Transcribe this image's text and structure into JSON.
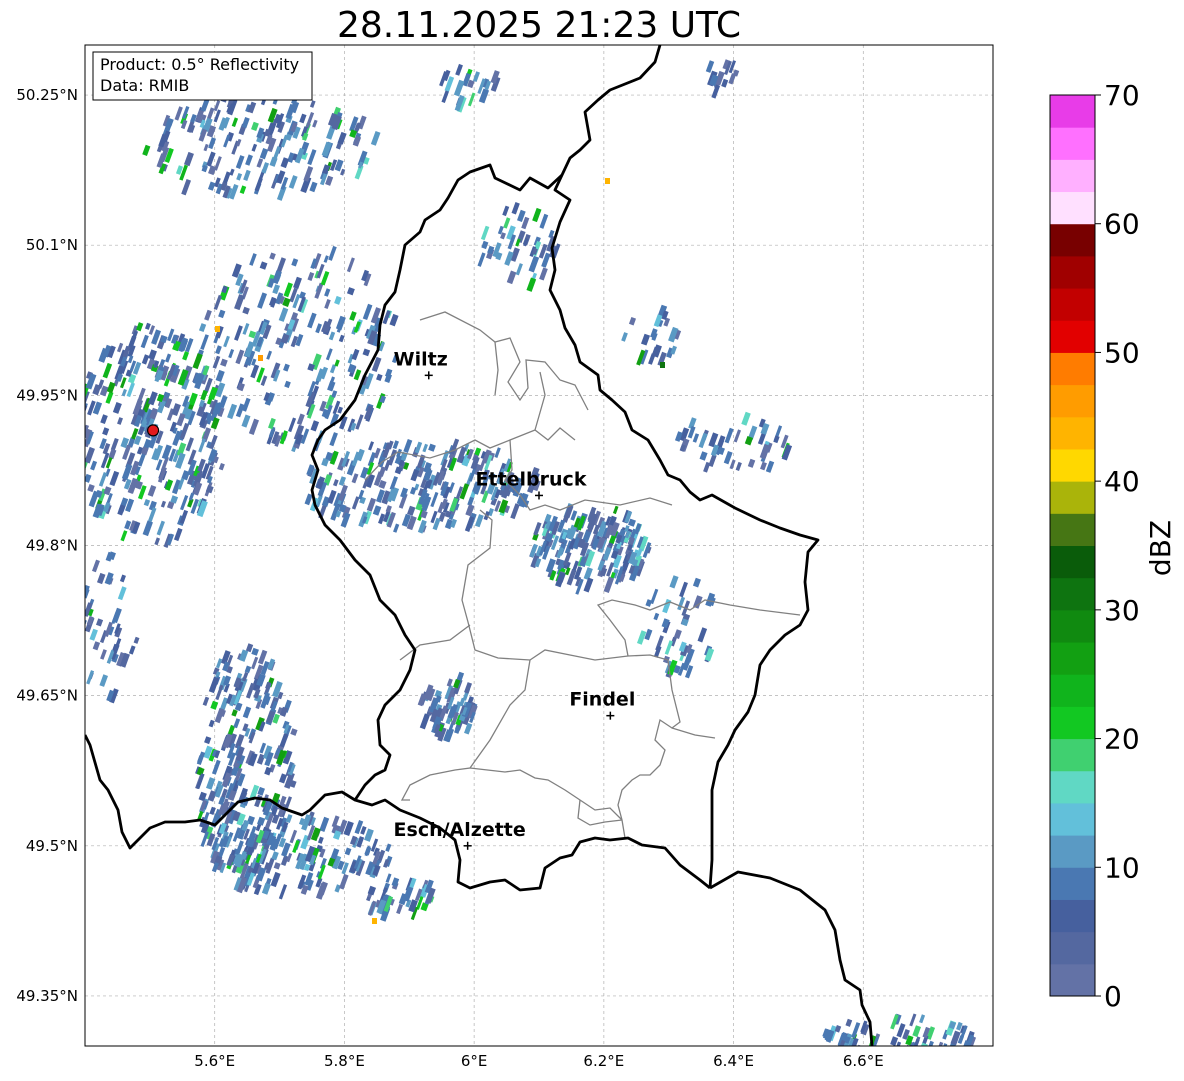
{
  "title": "28.11.2025 21:23 UTC",
  "info_box": {
    "product": "Product: 0.5° Reflectivity",
    "data": "Data: RMIB"
  },
  "axes": {
    "lon_range": [
      5.4,
      6.8
    ],
    "lat_range": [
      49.3,
      50.3
    ],
    "x_ticks": [
      {
        "value": 5.6,
        "label": "5.6°E"
      },
      {
        "value": 5.8,
        "label": "5.8°E"
      },
      {
        "value": 6.0,
        "label": "6°E"
      },
      {
        "value": 6.2,
        "label": "6.2°E"
      },
      {
        "value": 6.4,
        "label": "6.4°E"
      },
      {
        "value": 6.6,
        "label": "6.6°E"
      }
    ],
    "y_ticks": [
      {
        "value": 50.25,
        "label": "50.25°N"
      },
      {
        "value": 50.1,
        "label": "50.1°N"
      },
      {
        "value": 49.95,
        "label": "49.95°N"
      },
      {
        "value": 49.8,
        "label": "49.8°N"
      },
      {
        "value": 49.65,
        "label": "49.65°N"
      },
      {
        "value": 49.5,
        "label": "49.5°N"
      },
      {
        "value": 49.35,
        "label": "49.35°N"
      }
    ]
  },
  "cities": [
    {
      "name": "Wiltz",
      "lon": 5.93,
      "lat": 49.97
    },
    {
      "name": "Ettelbruck",
      "lon": 6.1,
      "lat": 49.85
    },
    {
      "name": "Findel",
      "lon": 6.21,
      "lat": 49.63
    },
    {
      "name": "Esch/Alzette",
      "lon": 5.99,
      "lat": 49.5
    }
  ],
  "radar_site": {
    "lon": 5.505,
    "lat": 49.915,
    "color": "#e31a1c"
  },
  "colorbar": {
    "label": "dBZ",
    "min": 0,
    "max": 70,
    "step": 2.5,
    "ticks": [
      0,
      10,
      20,
      30,
      40,
      50,
      60,
      70
    ],
    "colors": [
      "#6372a6",
      "#5468a0",
      "#46609e",
      "#4a78b2",
      "#5a9ac4",
      "#62c0da",
      "#60d8c4",
      "#40d070",
      "#12c822",
      "#10b41c",
      "#12a012",
      "#108a10",
      "#0e7410",
      "#0a5c0a",
      "#467614",
      "#aab40a",
      "#ffd800",
      "#ffb400",
      "#ff9c00",
      "#ff7c00",
      "#e20000",
      "#c20000",
      "#a00000",
      "#780000",
      "#ffe0ff",
      "#ffb0ff",
      "#ff70ff",
      "#e83ce8"
    ]
  }
}
